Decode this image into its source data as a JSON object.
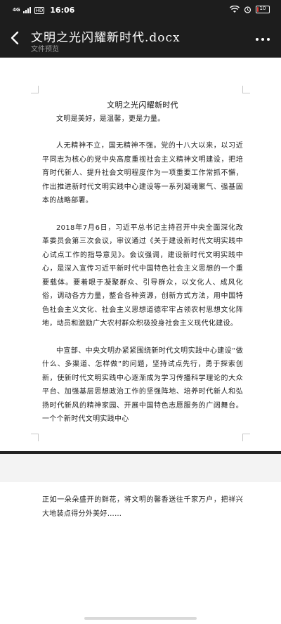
{
  "status_bar": {
    "signal_label": "4G",
    "hd_label": "HD",
    "time": "16:06",
    "battery_text": "10",
    "battery_level": 0.1,
    "battery_color": "#e53935"
  },
  "header": {
    "title": "文明之光闪耀新时代.docx",
    "subtitle": "文件预览",
    "back_icon": "chevron-left-icon",
    "more_icon": "more-dots-icon"
  },
  "document": {
    "heading": "文明之光闪耀新时代",
    "intro": "文明是美好，是温馨，更是力量。",
    "paragraphs": [
      "人无精神不立，国无精神不强。党的十八大以来，以习近平同志为核心的党中央高度重视社会主义精神文明建设，把培育时代新人、提升社会文明程度作为一项重要工作常抓不懈，作出推进新时代文明实践中心建设等一系列凝魂聚气、强基固本的战略部署。",
      "2018年7月6日，习近平总书记主持召开中央全面深化改革委员会第三次会议，审议通过《关于建设新时代文明实践中心试点工作的指导意见》。会议强调，建设新时代文明实践中心，是深入宣传习近平新时代中国特色社会主义思想的一个重要载体。要着眼于凝聚群众、引导群众，以文化人、成风化俗，调动各方力量，整合各种资源，创新方式方法，用中国特色社会主义文化、社会主义思想道德牢牢占领农村思想文化阵地，动员和激励广大农村群众积极投身社会主义现代化建设。",
      "中宣部、中央文明办紧紧围绕新时代文明实践中心建设“做什么、多渠道、怎样做”的问题，坚持试点先行，勇于探索创新，使新时代文明实践中心逐渐成为学习传播科学理论的大众平台、加强基层思想政治工作的坚强阵地、培养时代新人和弘扬时代新风的精神家园、开展中国特色志愿服务的广阔舞台。一个个新时代文明实践中心"
    ],
    "page2_text": "正如一朵朵盛开的鲜花，将文明的馨香送往千家万户，把祥兴大地装点得分外美好……"
  }
}
